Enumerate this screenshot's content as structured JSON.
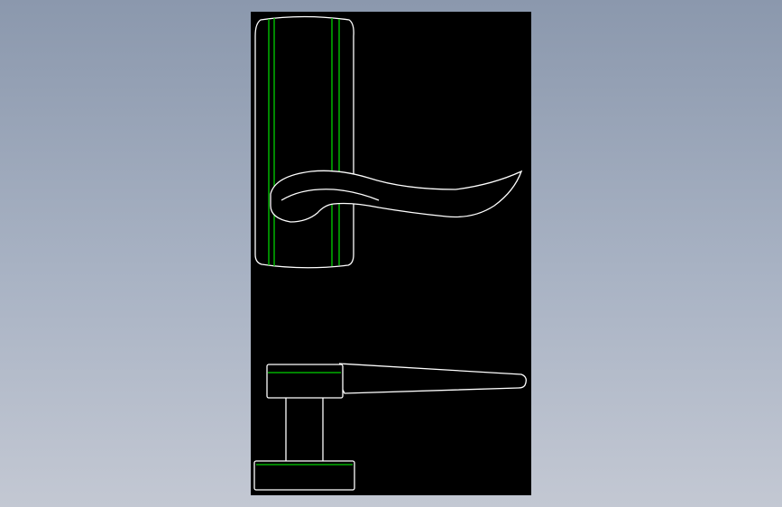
{
  "drawing": {
    "background": "#000000",
    "line_colors": {
      "outline": "#ffffff",
      "highlight": "#00d000"
    },
    "views": [
      {
        "name": "front-view"
      },
      {
        "name": "top-view"
      }
    ]
  }
}
